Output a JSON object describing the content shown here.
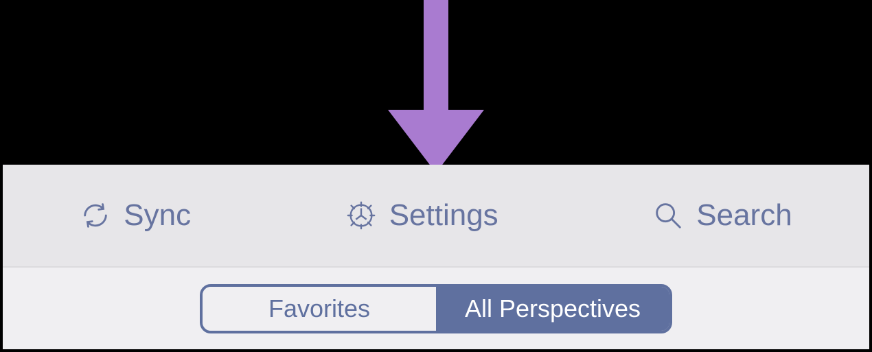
{
  "toolbar": {
    "sync_label": "Sync",
    "settings_label": "Settings",
    "search_label": "Search"
  },
  "segmented": {
    "favorites_label": "Favorites",
    "all_perspectives_label": "All Perspectives",
    "active": "all_perspectives"
  },
  "annotation": {
    "arrow_color": "#A97BD0",
    "points_to": "settings"
  },
  "colors": {
    "accent": "#5f709f",
    "panel_bg": "#f0eff2",
    "toolbar_bg": "#e7e6e9"
  }
}
